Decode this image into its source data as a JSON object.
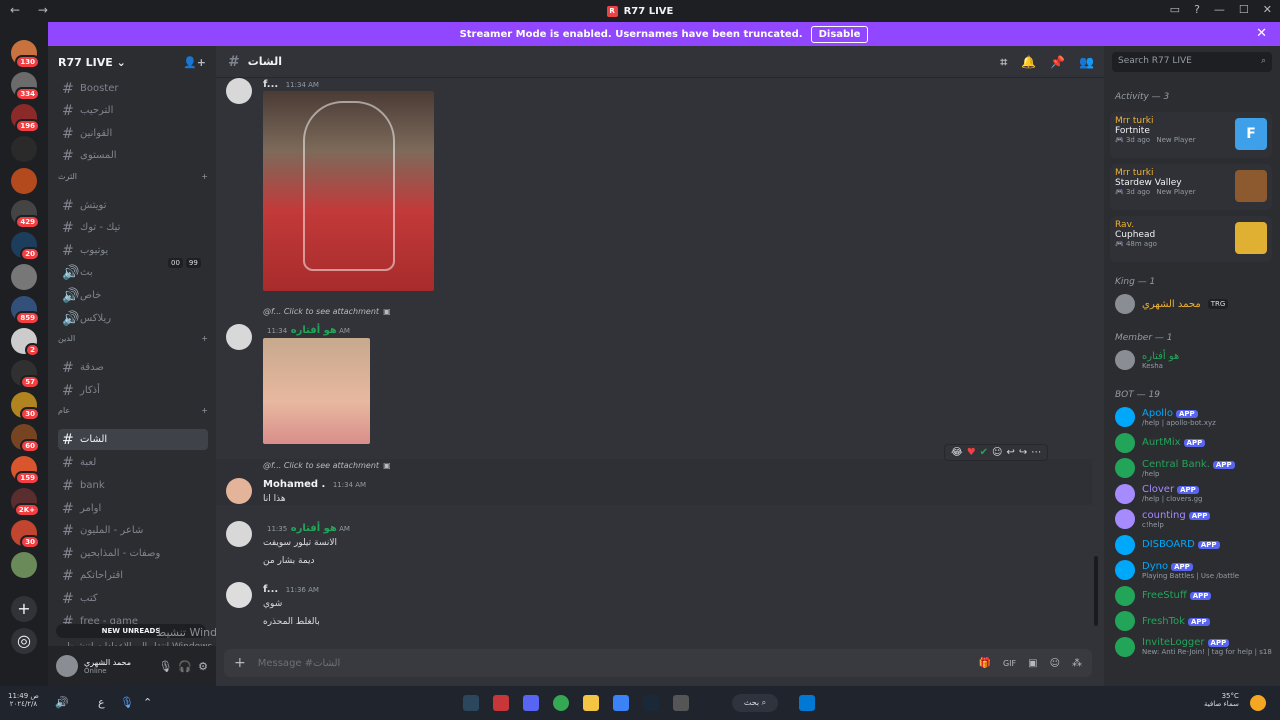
{
  "titlebar": {
    "back": "←",
    "forward": "→",
    "logo_text": "R",
    "title": "R77 LIVE",
    "icons": [
      "inbox-icon",
      "help-icon",
      "minimize-icon",
      "maximize-icon",
      "close-icon"
    ]
  },
  "banner": {
    "text": "Streamer Mode is enabled. Usernames have been truncated.",
    "button": "Disable"
  },
  "servers": [
    {
      "badge": "130"
    },
    {
      "badge": "334"
    },
    {
      "badge": "196"
    },
    {
      "badge": ""
    },
    {
      "badge": ""
    },
    {
      "badge": "429"
    },
    {
      "badge": "20"
    },
    {
      "badge": ""
    },
    {
      "badge": "859"
    },
    {
      "badge": "2"
    },
    {
      "badge": "57"
    },
    {
      "badge": "30"
    },
    {
      "badge": "60"
    },
    {
      "badge": "159"
    },
    {
      "badge": "2K+"
    },
    {
      "badge": "30"
    },
    {
      "badge": ""
    }
  ],
  "sidebar": {
    "guild": "R77 LIVE",
    "channels": [
      {
        "name": "Booster",
        "icon": "#"
      },
      {
        "name": "الترحيب",
        "icon": "#"
      },
      {
        "name": "القوانين",
        "icon": "#"
      },
      {
        "name": "المستوى",
        "icon": "#"
      },
      {
        "name": "تويتش",
        "icon": "#"
      },
      {
        "name": "تيك - توك",
        "icon": "#"
      },
      {
        "name": "يوتيوب",
        "icon": "#"
      },
      {
        "name": "بث",
        "icon": "🔊"
      },
      {
        "name": "خاص",
        "icon": "🔊"
      },
      {
        "name": "ريلاكس",
        "icon": "🔊"
      },
      {
        "name": "صدقة",
        "icon": "#"
      },
      {
        "name": "أذكار",
        "icon": "#"
      },
      {
        "name": "الشات",
        "icon": "#"
      },
      {
        "name": "لعبة",
        "icon": "#"
      },
      {
        "name": "bank",
        "icon": "#"
      },
      {
        "name": "اوامر",
        "icon": "#"
      },
      {
        "name": "شاعر - المليون",
        "icon": "#"
      },
      {
        "name": "وصفات - المذابحين",
        "icon": "#"
      },
      {
        "name": "اقتراحاتكم",
        "icon": "#"
      },
      {
        "name": "كتب",
        "icon": "#"
      },
      {
        "name": "free - game",
        "icon": "#"
      }
    ],
    "categories": [
      "الثرث",
      "الدين",
      "عام"
    ],
    "voice_counts": [
      "00",
      "99"
    ],
    "new_unreads": "NEW UNREADS"
  },
  "user": {
    "name": "محمد الشهري",
    "status": "Online"
  },
  "watermark": {
    "line1": "تنشيط Windows",
    "line2": "انتقل إلى الإعدادات لتنشيط Windows."
  },
  "chat": {
    "channel": "الشات",
    "messages": [
      {
        "author": "f...",
        "time": "11:34 AM"
      },
      {
        "reply": "@f... Click to see attachment",
        "author": "هو أفتاره",
        "time": "11:34 AM"
      },
      {
        "reply": "@f... Click to see attachment",
        "author": "Mohamed .",
        "time": "11:34 AM",
        "text": "هذا انا"
      },
      {
        "author": "هو أفتاره",
        "time": "11:35 AM",
        "lines": [
          "الانسة تيلور سويفت",
          "ديمة بشار من"
        ]
      },
      {
        "author": "f...",
        "time": "11:36 AM",
        "lines": [
          "شوي",
          "بالغلط المحذره"
        ]
      }
    ],
    "composer_placeholder": "Message #الشات"
  },
  "members": {
    "search": "Search R77 LIVE",
    "activity_title": "Activity — 3",
    "activities": [
      {
        "user": "Mrr turki",
        "game": "Fortnite",
        "ago": "3d ago",
        "tag": "New Player",
        "thumb": "F"
      },
      {
        "user": "Mrr turki",
        "game": "Stardew Valley",
        "ago": "3d ago",
        "tag": "New Player",
        "thumb": ""
      },
      {
        "user": "Rav.",
        "game": "Cuphead",
        "ago": "48m ago",
        "tag": "",
        "thumb": ""
      }
    ],
    "king_title": "King — 1",
    "king": {
      "name": "محمد الشهري",
      "tag": "TRG"
    },
    "member_title": "Member — 1",
    "member": {
      "name": "هو أفتاره",
      "status": "Kesha"
    },
    "bot_title": "BOT — 19",
    "bots": [
      {
        "name": "Apollo",
        "status": "/help | apollo-bot.xyz",
        "color": "#00a8fc"
      },
      {
        "name": "AurtMix",
        "status": "",
        "color": "#23a559"
      },
      {
        "name": "Central Bank.",
        "status": "/help",
        "color": "#23a559"
      },
      {
        "name": "Clover",
        "status": "/help | clovers.gg",
        "color": "#a68bff"
      },
      {
        "name": "counting",
        "status": "c!help",
        "color": "#a68bff"
      },
      {
        "name": "DISBOARD",
        "status": "",
        "color": "#00a8fc"
      },
      {
        "name": "Dyno",
        "status": "Playing Battles | Use /battle",
        "color": "#00a8fc"
      },
      {
        "name": "FreeStuff",
        "status": "",
        "color": "#23a559"
      },
      {
        "name": "FreshTok",
        "status": "",
        "color": "#23a559"
      },
      {
        "name": "InviteLogger",
        "status": "New: Anti Re-Join! | tag for help | s18",
        "color": "#23a559"
      }
    ],
    "app_label": "APP"
  },
  "taskbar": {
    "time": "11:49 ص",
    "date": "٢٠٢٤/٢/٨",
    "lang": "ع",
    "search": "بحث",
    "weather_temp": "35°C",
    "weather_text": "سماء صافية"
  }
}
